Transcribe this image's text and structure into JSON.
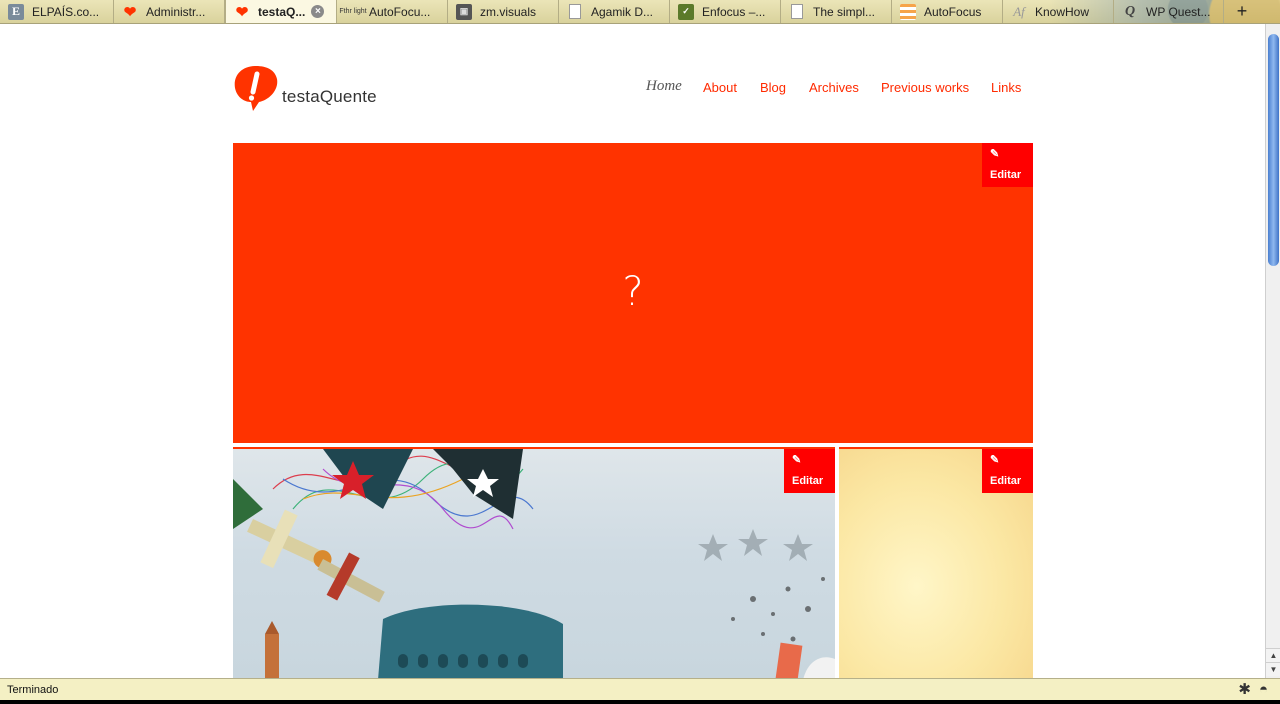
{
  "browser": {
    "tabs": [
      {
        "label": "ELPAÍS.co...",
        "icon": "elpais-favicon",
        "fav_text": "E"
      },
      {
        "label": "Administr...",
        "icon": "testaquente-favicon",
        "fav_text": "❤"
      },
      {
        "label": "testaQ...",
        "icon": "testaquente-favicon",
        "fav_text": "❤",
        "active": true
      },
      {
        "label": "AutoFocu...",
        "icon": "fthrlight-favicon",
        "fav_text": "Fthr light"
      },
      {
        "label": "zm.visuals",
        "icon": "zm-favicon",
        "fav_text": "▣"
      },
      {
        "label": "Agamik D...",
        "icon": "page-icon",
        "fav_text": ""
      },
      {
        "label": "Enfocus –...",
        "icon": "enfocus-favicon",
        "fav_text": "✓"
      },
      {
        "label": "The simpl...",
        "icon": "page-icon",
        "fav_text": ""
      },
      {
        "label": "AutoFocus",
        "icon": "autofocus-favicon",
        "fav_text": ""
      },
      {
        "label": "KnowHow",
        "icon": "af-favicon",
        "fav_text": "Af"
      },
      {
        "label": "WP Quest...",
        "icon": "q-favicon",
        "fav_text": "Q"
      }
    ],
    "new_tab_label": "+",
    "close_tab_label": "×",
    "status_text": "Terminado"
  },
  "site": {
    "logo_text": "testaQuente",
    "nav": [
      "Home",
      "About",
      "Blog",
      "Archives",
      "Previous works",
      "Links"
    ],
    "hero_symbol": "?",
    "edit_label": "Editar",
    "edit_icon": "✎"
  },
  "colors": {
    "brand_red": "#ff3300",
    "edit_red": "#ff0000",
    "nav_link": "#ff2a00"
  }
}
